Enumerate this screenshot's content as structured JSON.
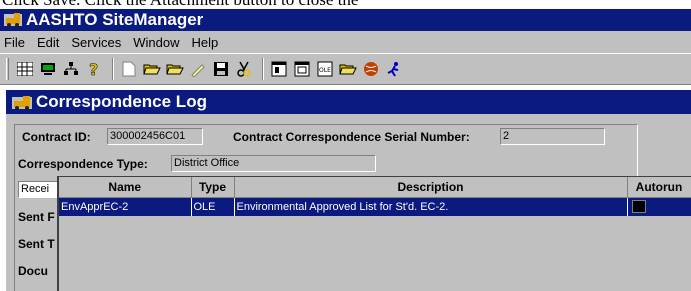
{
  "caption": "Click Save.  Click the Attachment button to close the",
  "app": {
    "title": "AASHTO SiteManager"
  },
  "menu": [
    "File",
    "Edit",
    "Services",
    "Window",
    "Help"
  ],
  "window": {
    "title": "Correspondence Log"
  },
  "form": {
    "contract_id_label": "Contract ID:",
    "contract_id_value": "300002456C01",
    "serial_label": "Contract Correspondence Serial Number:",
    "serial_value": "2",
    "type_label": "Correspondence Type:",
    "type_value": "District Office",
    "received_partial": "Recei",
    "sent_label_1": "Sent F",
    "sent_label_2": "Sent T",
    "docu_label": "Docu"
  },
  "attachments": {
    "columns": [
      "Name",
      "Type",
      "Description",
      "Autorun"
    ],
    "rows": [
      {
        "name": "EnvApprEC-2",
        "type": "OLE",
        "description": "Environmental Approved List for St'd. EC-2."
      }
    ]
  },
  "colors": {
    "title_bar": "#0a1a7e",
    "chrome": "#c0c0c0",
    "selected_row": "#0a1a7e"
  },
  "toolbar_icons": [
    "grid-icon",
    "monitor-icon",
    "hierarchy-icon",
    "help-icon",
    "blank-doc-icon",
    "open-folder-icon",
    "open-folder-2-icon",
    "clear-icon",
    "save-icon",
    "cut-icon",
    "window-1-icon",
    "window-2-icon",
    "ole-icon",
    "folder-3-icon",
    "globe-icon",
    "runner-icon"
  ]
}
